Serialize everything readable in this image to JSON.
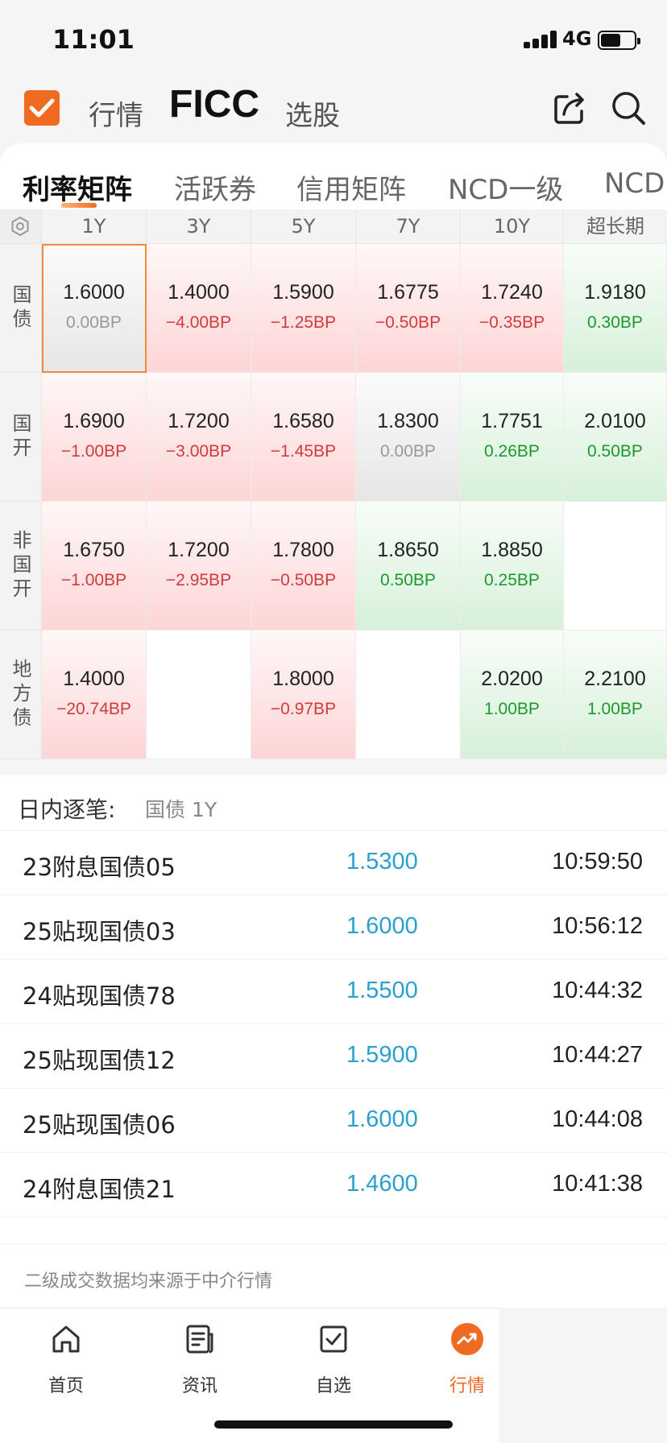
{
  "status_bar": {
    "time": "11:01",
    "network": "4G"
  },
  "header": {
    "tabs": [
      {
        "label": "行情"
      },
      {
        "label": "FICC"
      },
      {
        "label": "选股"
      }
    ]
  },
  "sub_tabs": [
    {
      "label": "利率矩阵"
    },
    {
      "label": "活跃券"
    },
    {
      "label": "信用矩阵"
    },
    {
      "label": "NCD一级"
    },
    {
      "label": "NCD"
    }
  ],
  "matrix": {
    "columns": [
      "1Y",
      "3Y",
      "5Y",
      "7Y",
      "10Y",
      "超长期"
    ],
    "rows": [
      {
        "label": "国债",
        "cells": [
          {
            "value": "1.6000",
            "change": "0.00BP",
            "tone": "gray",
            "selected": true
          },
          {
            "value": "1.4000",
            "change": "−4.00BP",
            "tone": "red"
          },
          {
            "value": "1.5900",
            "change": "−1.25BP",
            "tone": "red"
          },
          {
            "value": "1.6775",
            "change": "−0.50BP",
            "tone": "red"
          },
          {
            "value": "1.7240",
            "change": "−0.35BP",
            "tone": "red"
          },
          {
            "value": "1.9180",
            "change": "0.30BP",
            "tone": "green"
          }
        ]
      },
      {
        "label": "国开",
        "cells": [
          {
            "value": "1.6900",
            "change": "−1.00BP",
            "tone": "red"
          },
          {
            "value": "1.7200",
            "change": "−3.00BP",
            "tone": "red"
          },
          {
            "value": "1.6580",
            "change": "−1.45BP",
            "tone": "red"
          },
          {
            "value": "1.8300",
            "change": "0.00BP",
            "tone": "gray"
          },
          {
            "value": "1.7751",
            "change": "0.26BP",
            "tone": "green"
          },
          {
            "value": "2.0100",
            "change": "0.50BP",
            "tone": "green"
          }
        ]
      },
      {
        "label": "非国开",
        "cells": [
          {
            "value": "1.6750",
            "change": "−1.00BP",
            "tone": "red"
          },
          {
            "value": "1.7200",
            "change": "−2.95BP",
            "tone": "red"
          },
          {
            "value": "1.7800",
            "change": "−0.50BP",
            "tone": "red"
          },
          {
            "value": "1.8650",
            "change": "0.50BP",
            "tone": "green"
          },
          {
            "value": "1.8850",
            "change": "0.25BP",
            "tone": "green"
          },
          {
            "value": "",
            "change": "",
            "tone": "empty"
          }
        ]
      },
      {
        "label": "地方债",
        "cells": [
          {
            "value": "1.4000",
            "change": "−20.74BP",
            "tone": "red"
          },
          {
            "value": "",
            "change": "",
            "tone": "empty"
          },
          {
            "value": "1.8000",
            "change": "−0.97BP",
            "tone": "red"
          },
          {
            "value": "",
            "change": "",
            "tone": "empty"
          },
          {
            "value": "2.0200",
            "change": "1.00BP",
            "tone": "green"
          },
          {
            "value": "2.2100",
            "change": "1.00BP",
            "tone": "green"
          }
        ]
      }
    ]
  },
  "trades": {
    "title": "日内逐笔:",
    "subtitle": "国债 1Y",
    "rows": [
      {
        "name": "23附息国债05",
        "price": "1.5300",
        "time": "10:59:50"
      },
      {
        "name": "25贴现国债03",
        "price": "1.6000",
        "time": "10:56:12"
      },
      {
        "name": "24贴现国债78",
        "price": "1.5500",
        "time": "10:44:32"
      },
      {
        "name": "25贴现国债12",
        "price": "1.5900",
        "time": "10:44:27"
      },
      {
        "name": "25贴现国债06",
        "price": "1.6000",
        "time": "10:44:08"
      },
      {
        "name": "24附息国债21",
        "price": "1.4600",
        "time": "10:41:38"
      }
    ]
  },
  "footnote": "二级成交数据均来源于中介行情",
  "bottom_nav": [
    {
      "label": "首页",
      "icon": "home-icon"
    },
    {
      "label": "资讯",
      "icon": "news-icon"
    },
    {
      "label": "自选",
      "icon": "watchlist-icon"
    },
    {
      "label": "行情",
      "icon": "market-trend-icon"
    }
  ],
  "colors": {
    "accent": "#f06a22",
    "up": "#d43a3a",
    "down": "#1c9a2e",
    "price": "#2a9fd0"
  }
}
